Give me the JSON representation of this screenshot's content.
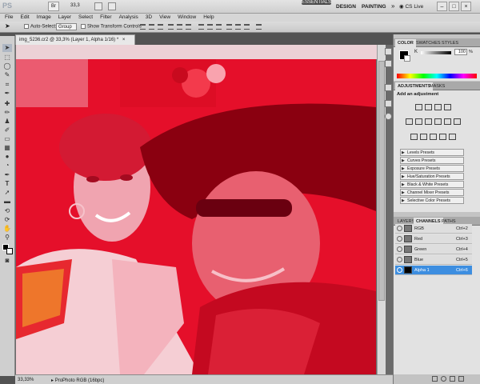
{
  "app": {
    "logo": "PS",
    "menus": [
      "File",
      "Edit",
      "Image",
      "Layer",
      "Select",
      "Filter",
      "Analysis",
      "3D",
      "View",
      "Window",
      "Help"
    ],
    "zoom_select": "33,3"
  },
  "workspaces": {
    "essentials": "ESSENTIALS",
    "design": "DESIGN",
    "painting": "PAINTING",
    "more": "»",
    "cslive": "CS Live"
  },
  "window": {
    "minimize": "–",
    "restore": "□",
    "close": "×"
  },
  "options": {
    "auto_select_label": "Auto-Select:",
    "group_value": "Group",
    "transform_label": "Show Transform Controls"
  },
  "document": {
    "tab_title": "img_5236.cr2 @ 33,3% (Layer 1, Alpha 1/16) *",
    "close": "×",
    "status_zoom": "33,33%",
    "status_info": "ProPhoto RGB (16bpc)"
  },
  "colors": {
    "photo_tint": "#e50f2a",
    "accent": "#3d8ee0"
  },
  "color_panel": {
    "tabs": [
      "COLOR",
      "SWATCHES",
      "STYLES"
    ],
    "k_label": "K",
    "k_value": "100",
    "k_unit": "%"
  },
  "adjustments": {
    "tabs": [
      "ADJUSTMENTS",
      "MASKS"
    ],
    "heading": "Add an adjustment",
    "presets": [
      "Levels Presets",
      "Curves Presets",
      "Exposure Presets",
      "Hue/Saturation Presets",
      "Black & White Presets",
      "Channel Mixer Presets",
      "Selective Color Presets"
    ]
  },
  "layers": {
    "tabs": [
      "LAYERS",
      "CHANNELS",
      "PATHS"
    ],
    "channels": [
      {
        "name": "RGB",
        "shortcut": "Ctrl+2"
      },
      {
        "name": "Red",
        "shortcut": "Ctrl+3"
      },
      {
        "name": "Green",
        "shortcut": "Ctrl+4"
      },
      {
        "name": "Blue",
        "shortcut": "Ctrl+5"
      },
      {
        "name": "Alpha 1",
        "shortcut": "Ctrl+6"
      }
    ]
  }
}
